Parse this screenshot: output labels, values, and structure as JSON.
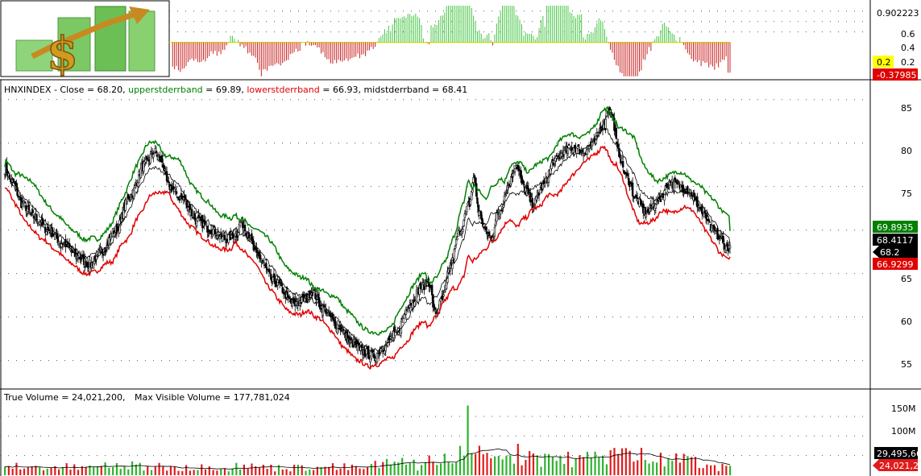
{
  "colors": {
    "background": "#ffffff",
    "upper_band": "#008000",
    "lower_band": "#e00000",
    "mid_band": "#000000",
    "volume_up": "#2db32d",
    "volume_down": "#e21b1b",
    "osc_up": "#44c544",
    "osc_down": "#c82020",
    "osc_ref_line": "#e6e600",
    "badge_yellow": "#ffff00"
  },
  "logo": {
    "icon": "dollar-arrow-logo-icon"
  },
  "oscillator_panel": {
    "ticks": [
      "0.6",
      "0.4",
      "0.2"
    ],
    "top_value": "0.902223",
    "ref_badge": "0.2",
    "current_badge": "-0.37985"
  },
  "price_panel": {
    "header": {
      "symbol_close": "HNXINDEX - Close = 68.20,",
      "upper_label": "upperstderrband",
      "upper_value": "= 69.89,",
      "lower_label": "lowerstderrband",
      "lower_value": "= 66.93,",
      "mid_label": "midstderrband",
      "mid_value": "= 68.41"
    },
    "ticks": [
      "85",
      "80",
      "75",
      "65",
      "60",
      "55"
    ],
    "badges": {
      "upper": "69.8935",
      "mid": "68.4117",
      "close": "68.2",
      "lower": "66.9299"
    }
  },
  "volume_panel": {
    "header": {
      "true_volume": "True Volume = 24,021,200,",
      "max_visible": "Max Visible Volume = 177,781,024"
    },
    "ticks": [
      "150M",
      "100M"
    ],
    "badges": {
      "avg": "29,495,66",
      "current": "24,021,20"
    }
  },
  "chart_data": {
    "type": "candlestick-with-bands",
    "price_ylim": [
      52,
      87
    ],
    "volume_ylim": [
      0,
      185
    ],
    "osc_ylim": [
      -0.5,
      0.95
    ],
    "close_anchors": [
      [
        0,
        77
      ],
      [
        8,
        75.5
      ],
      [
        18,
        73
      ],
      [
        30,
        71.5
      ],
      [
        45,
        70
      ],
      [
        60,
        68.5
      ],
      [
        75,
        67
      ],
      [
        88,
        66
      ],
      [
        100,
        67.5
      ],
      [
        115,
        70
      ],
      [
        130,
        74
      ],
      [
        145,
        77.5
      ],
      [
        155,
        79
      ],
      [
        162,
        78
      ],
      [
        170,
        75
      ],
      [
        185,
        73.5
      ],
      [
        200,
        71
      ],
      [
        215,
        70
      ],
      [
        228,
        69
      ],
      [
        240,
        69.5
      ],
      [
        245,
        71
      ],
      [
        250,
        70
      ],
      [
        262,
        67
      ],
      [
        280,
        64
      ],
      [
        300,
        61.5
      ],
      [
        312,
        62
      ],
      [
        318,
        63
      ],
      [
        330,
        61
      ],
      [
        345,
        59
      ],
      [
        360,
        57
      ],
      [
        372,
        56
      ],
      [
        382,
        55.5
      ],
      [
        392,
        56.5
      ],
      [
        405,
        58
      ],
      [
        420,
        61.5
      ],
      [
        432,
        63.5
      ],
      [
        440,
        64
      ],
      [
        446,
        60.5
      ],
      [
        454,
        62
      ],
      [
        462,
        66
      ],
      [
        472,
        70
      ],
      [
        482,
        73
      ],
      [
        486,
        76
      ],
      [
        492,
        72
      ],
      [
        498,
        70
      ],
      [
        504,
        69
      ],
      [
        512,
        72
      ],
      [
        522,
        75
      ],
      [
        530,
        77.5
      ],
      [
        538,
        75
      ],
      [
        548,
        73
      ],
      [
        558,
        75
      ],
      [
        570,
        78
      ],
      [
        580,
        79
      ],
      [
        590,
        79.5
      ],
      [
        600,
        79
      ],
      [
        610,
        80
      ],
      [
        620,
        82
      ],
      [
        626,
        84
      ],
      [
        630,
        83
      ],
      [
        636,
        79
      ],
      [
        645,
        76
      ],
      [
        655,
        73.5
      ],
      [
        665,
        72
      ],
      [
        678,
        73.5
      ],
      [
        690,
        75.5
      ],
      [
        700,
        75
      ],
      [
        710,
        74.5
      ],
      [
        718,
        73
      ],
      [
        726,
        71.5
      ],
      [
        734,
        70
      ],
      [
        742,
        69
      ],
      [
        748,
        68
      ],
      [
        752,
        68.2
      ]
    ],
    "series": [
      {
        "name": "Close",
        "value": 68.2
      },
      {
        "name": "upperstderrband",
        "value": 69.89
      },
      {
        "name": "lowerstderrband",
        "value": 66.93
      },
      {
        "name": "midstderrband",
        "value": 68.41
      }
    ],
    "volume": {
      "true_volume": 24021200,
      "max_visible": 177781024,
      "average": 29495660
    },
    "oscillator": {
      "max": 0.902223,
      "reference": 0.2,
      "current": -0.37985
    }
  }
}
